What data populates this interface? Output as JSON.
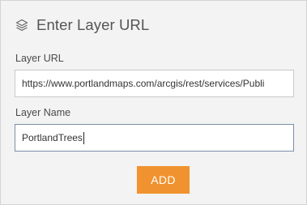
{
  "dialog": {
    "title": "Enter Layer URL",
    "title_icon": "layers-icon"
  },
  "layer_url": {
    "label": "Layer URL",
    "value": "https://www.portlandmaps.com/arcgis/rest/services/Publi"
  },
  "layer_name": {
    "label": "Layer Name",
    "value": "PortlandTrees"
  },
  "actions": {
    "add_label": "ADD"
  },
  "colors": {
    "panel_background": "#f3f3f3",
    "add_button": "#f0922f",
    "focused_border": "#7a8fa8"
  }
}
